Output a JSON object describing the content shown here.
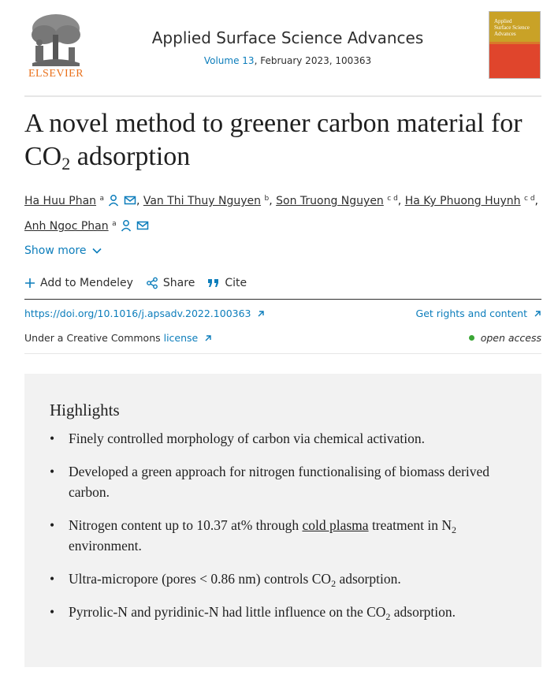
{
  "header": {
    "publisher": "ELSEVIER",
    "journal_title": "Applied Surface Science Advances",
    "volume": "Volume 13",
    "issue_rest": ", February 2023, 100363",
    "cover_title": "Applied Surface Science Advances"
  },
  "article": {
    "title_part1": "A novel method to greener carbon material for CO",
    "title_sub": "2",
    "title_part2": " adsorption"
  },
  "authors": [
    {
      "name": "Ha Huu Phan",
      "aff": "a"
    },
    {
      "name": "Van Thi Thuy Nguyen",
      "aff": "b"
    },
    {
      "name": "Son Truong Nguyen",
      "aff": "c d"
    },
    {
      "name": "Ha Ky Phuong Huynh",
      "aff": "c d"
    },
    {
      "name": "Anh Ngoc Phan",
      "aff": "a"
    }
  ],
  "show_more": "Show more",
  "actions": {
    "mendeley": "Add to Mendeley",
    "share": "Share",
    "cite": "Cite"
  },
  "links": {
    "doi": "https://doi.org/10.1016/j.apsadv.2022.100363",
    "rights": "Get rights and content",
    "license_prefix": "Under a Creative Commons ",
    "license_link": "license",
    "open_access": "open access"
  },
  "highlights": {
    "title": "Highlights",
    "item1": "Finely controlled morphology of carbon via chemical activation.",
    "item2": "Developed a green approach for nitrogen functionalising of biomass derived carbon.",
    "item3_pre": "Nitrogen content up to 10.37 at% through ",
    "item3_link": "cold plasma",
    "item3_mid": " treatment in N",
    "item3_sub": "2",
    "item3_post": " environment.",
    "item4_pre": "Ultra-micropore (pores < 0.86 nm) controls CO",
    "item4_sub": "2",
    "item4_post": " adsorption.",
    "item5_pre": "Pyrrolic-N and pyridinic-N had little influence on the CO",
    "item5_sub": "2",
    "item5_post": " adsorption."
  },
  "colors": {
    "link": "#0c7dbb",
    "publisher_orange": "#e9711c",
    "open_access_green": "#3aa635",
    "highlights_bg": "#f2f2f2"
  }
}
